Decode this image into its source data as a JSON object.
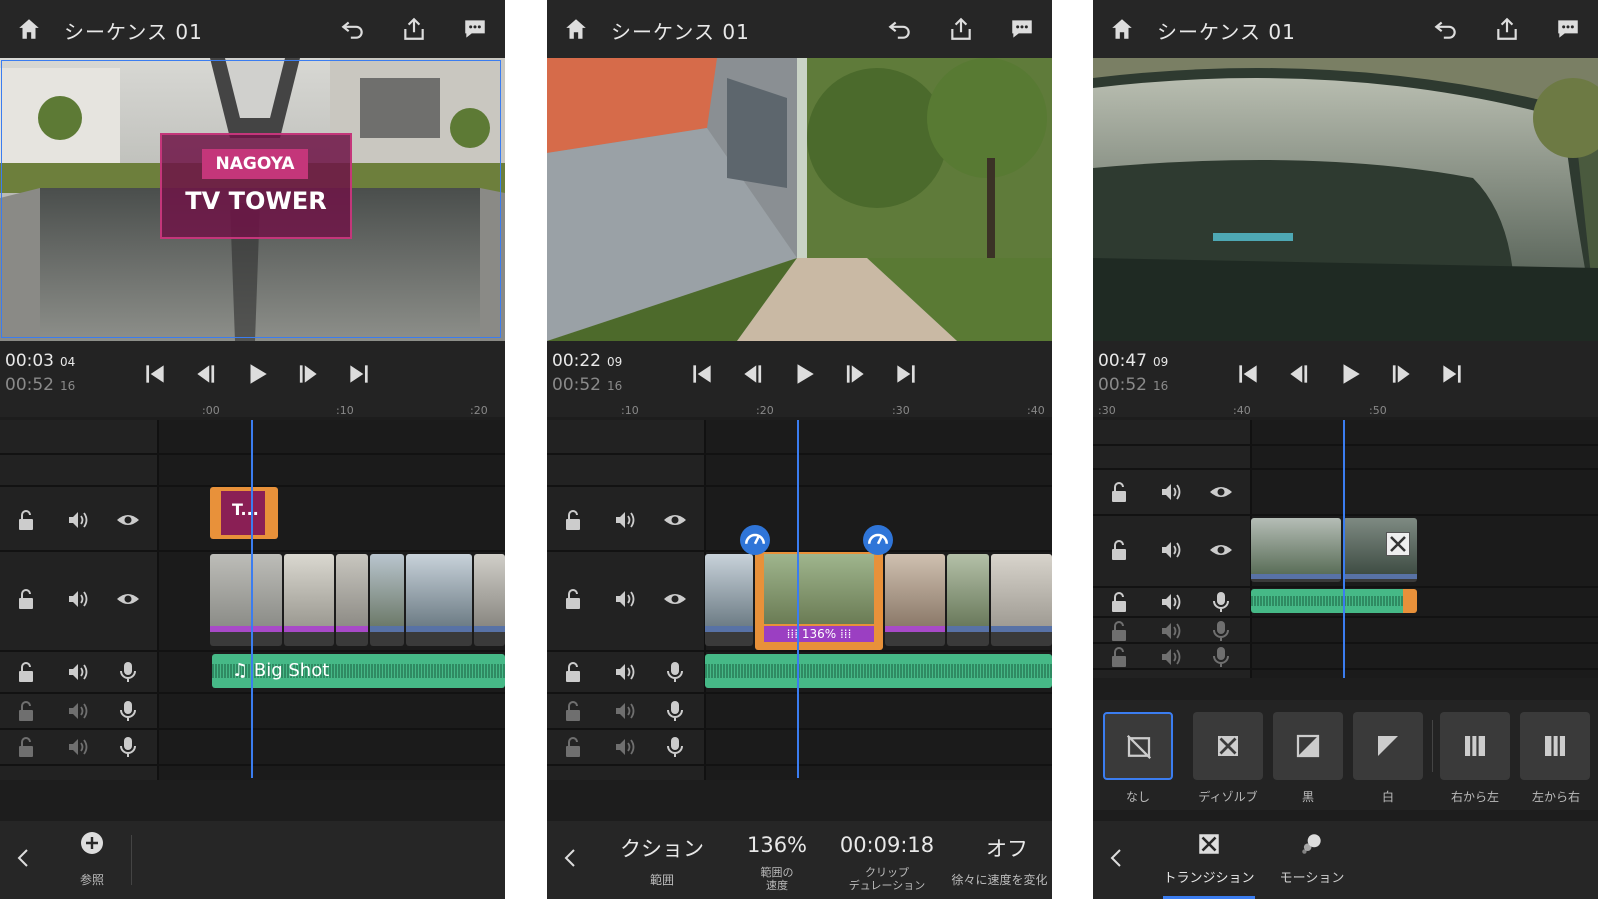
{
  "app": {
    "sequence_title": "シーケンス 01"
  },
  "panel1": {
    "timecode_current": "00:03",
    "timecode_current_frames": "04",
    "timecode_total": "00:52",
    "timecode_total_frames": "16",
    "ruler": [
      ":00",
      ":10",
      ":20"
    ],
    "title_card_top": "NAGOYA",
    "title_card_bottom": "TV TOWER",
    "title_clip_label": "T...",
    "audio_clip_label": "Big Shot",
    "browse_label": "参照"
  },
  "panel2": {
    "timecode_current": "00:22",
    "timecode_current_frames": "09",
    "timecode_total": "00:52",
    "timecode_total_frames": "16",
    "ruler": [
      ":10",
      ":20",
      ":30",
      ":40"
    ],
    "speed_badge": "136%",
    "options": [
      {
        "value": "クション",
        "label": "範囲"
      },
      {
        "value": "136%",
        "label": "範囲の\n速度"
      },
      {
        "value": "00:09:18",
        "label": "クリップ\nデュレーション"
      },
      {
        "value": "オフ",
        "label": "徐々に速度を変化"
      }
    ]
  },
  "panel3": {
    "timecode_current": "00:47",
    "timecode_current_frames": "09",
    "timecode_total": "00:52",
    "timecode_total_frames": "16",
    "ruler": [
      ":30",
      ":40",
      ":50"
    ],
    "transitions": [
      "なし",
      "ディゾルブ",
      "黒",
      "白",
      "右から左",
      "左から右"
    ],
    "tabs": [
      "トランジション",
      "モーション"
    ]
  },
  "colors": {
    "accent": "#3b7df0",
    "clip_orange": "#e8913a",
    "audio_green": "#46b987",
    "title_pink": "#c4367a",
    "speed_purple": "#9b3fc2"
  }
}
